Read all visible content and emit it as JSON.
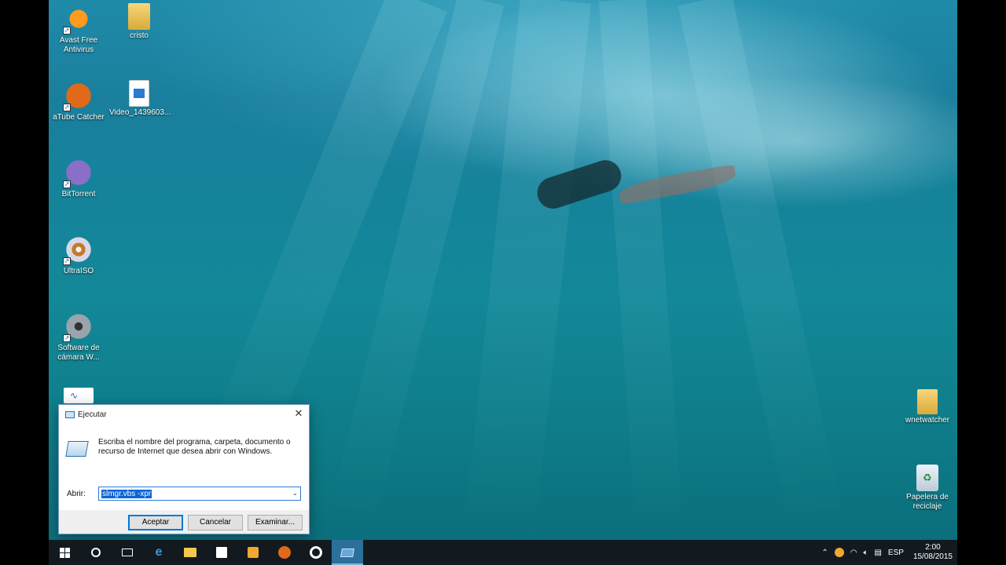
{
  "desktop": {
    "icons_left": [
      {
        "label": "Avast Free\nAntivirus",
        "icon": "avast-icon"
      },
      {
        "label": "cristo",
        "icon": "folder-icon"
      },
      {
        "label": "aTube Catcher",
        "icon": "atube-catcher-icon"
      },
      {
        "label": "Video_1439603...",
        "icon": "video-file-icon"
      },
      {
        "label": "BitTorrent",
        "icon": "bittorrent-icon"
      },
      {
        "label": "UltraISO",
        "icon": "ultraiso-icon"
      },
      {
        "label": "Software de\ncámara W...",
        "icon": "camera-software-icon"
      }
    ],
    "icons_right": [
      {
        "label": "wnetwatcher",
        "icon": "folder-icon"
      },
      {
        "label": "Papelera de\nreciclaje",
        "icon": "recycle-bin-icon"
      }
    ]
  },
  "run_dialog": {
    "title": "Ejecutar",
    "description": "Escriba el nombre del programa, carpeta, documento o recurso de Internet que desea abrir con Windows.",
    "open_label": "Abrir:",
    "command_value": "slmgr.vbs -xpr",
    "buttons": {
      "accept": "Aceptar",
      "cancel": "Cancelar",
      "browse": "Examinar..."
    }
  },
  "taskbar": {
    "language": "ESP",
    "time": "2:00",
    "date": "15/08/2015"
  },
  "colors": {
    "accent": "#0078d7",
    "taskbar_bg": "#121a1f",
    "selection": "#0a64d6"
  }
}
